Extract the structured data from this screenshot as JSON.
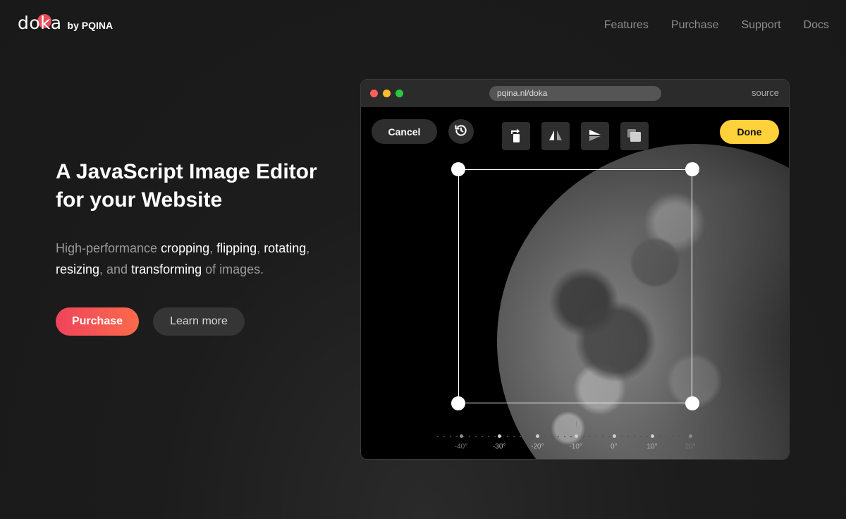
{
  "brand": {
    "logo_text": "doka",
    "by_text": "by PQINA",
    "accent": "#ea4c5b"
  },
  "nav": {
    "items": [
      {
        "label": "Features"
      },
      {
        "label": "Purchase"
      },
      {
        "label": "Support"
      },
      {
        "label": "Docs"
      }
    ]
  },
  "hero": {
    "title_line1": "A JavaScript Image Editor",
    "title_line2": "for your Website",
    "subtitle": {
      "prefix": "High-performance ",
      "cropping": "cropping",
      "sep1": ", ",
      "flipping": "flipping",
      "sep2": ", ",
      "rotating": "rotating",
      "sep3": ",",
      "resizing": "resizing",
      "sep4": ", and ",
      "transforming": "transforming",
      "suffix": " of images."
    },
    "purchase_label": "Purchase",
    "learn_more_label": "Learn more"
  },
  "window": {
    "url": "pqina.nl/doka",
    "source_label": "source"
  },
  "editor": {
    "cancel_label": "Cancel",
    "done_label": "Done",
    "done_color": "#ffd13a",
    "tools": [
      {
        "icon": "rotate-left-icon"
      },
      {
        "icon": "flip-horizontal-icon"
      },
      {
        "icon": "flip-vertical-icon"
      },
      {
        "icon": "aspect-ratio-icon"
      }
    ],
    "rotation_dial": {
      "labels": [
        "-40°",
        "-30°",
        "-20°",
        "-10°",
        "0°",
        "10°",
        "20°"
      ]
    }
  }
}
